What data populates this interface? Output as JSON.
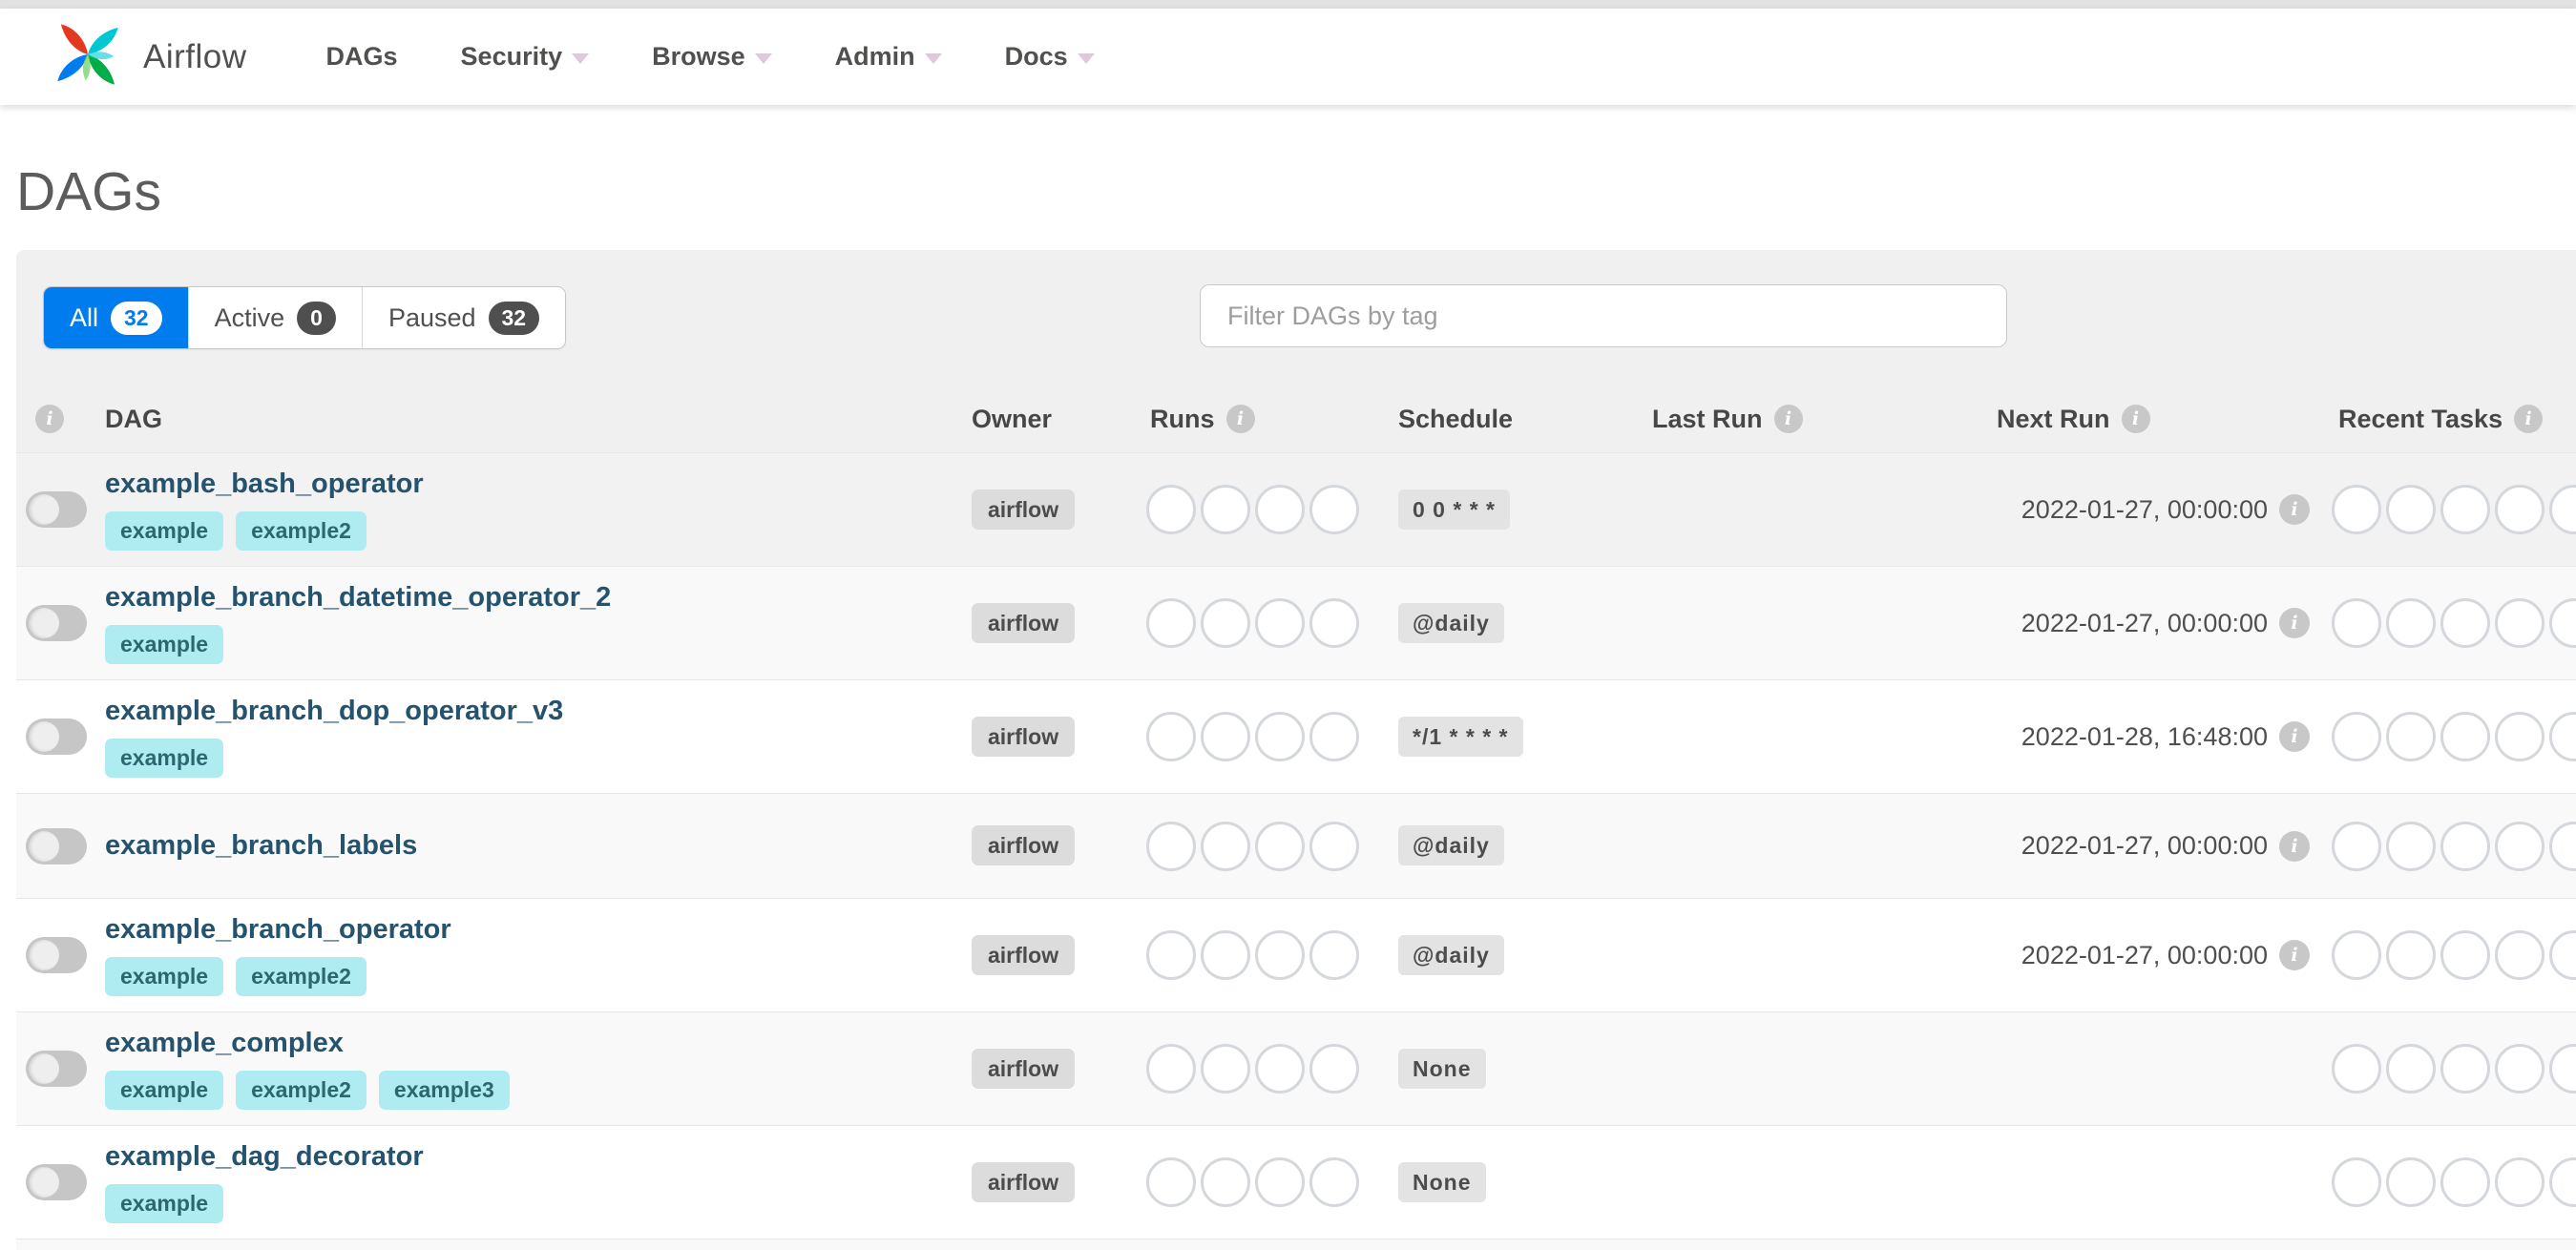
{
  "navbar": {
    "brand": "Airflow",
    "items": [
      {
        "label": "DAGs",
        "caret": false
      },
      {
        "label": "Security",
        "caret": true
      },
      {
        "label": "Browse",
        "caret": true
      },
      {
        "label": "Admin",
        "caret": true
      },
      {
        "label": "Docs",
        "caret": true
      }
    ]
  },
  "page": {
    "title": "DAGs"
  },
  "filters": {
    "tabs": [
      {
        "label": "All",
        "count": "32",
        "active": true
      },
      {
        "label": "Active",
        "count": "0",
        "active": false
      },
      {
        "label": "Paused",
        "count": "32",
        "active": false
      }
    ],
    "search_placeholder": "Filter DAGs by tag"
  },
  "table": {
    "headers": {
      "dag": "DAG",
      "owner": "Owner",
      "runs": "Runs",
      "schedule": "Schedule",
      "last_run": "Last Run",
      "next_run": "Next Run",
      "recent_tasks": "Recent Tasks"
    },
    "runs_circle_count": 4,
    "recent_circle_count": 5,
    "rows": [
      {
        "name": "example_bash_operator",
        "tags": [
          "example",
          "example2"
        ],
        "owner": "airflow",
        "schedule": "0 0 * * *",
        "last_run": "",
        "next_run": "2022-01-27, 00:00:00",
        "paused": true,
        "bg": "#f2f2f2"
      },
      {
        "name": "example_branch_datetime_operator_2",
        "tags": [
          "example"
        ],
        "owner": "airflow",
        "schedule": "@daily",
        "last_run": "",
        "next_run": "2022-01-27, 00:00:00",
        "paused": true,
        "bg": "#f9f9f9"
      },
      {
        "name": "example_branch_dop_operator_v3",
        "tags": [
          "example"
        ],
        "owner": "airflow",
        "schedule": "*/1 * * * *",
        "last_run": "",
        "next_run": "2022-01-28, 16:48:00",
        "paused": true,
        "bg": "#ffffff"
      },
      {
        "name": "example_branch_labels",
        "tags": [],
        "owner": "airflow",
        "schedule": "@daily",
        "last_run": "",
        "next_run": "2022-01-27, 00:00:00",
        "paused": true,
        "bg": "#f9f9f9"
      },
      {
        "name": "example_branch_operator",
        "tags": [
          "example",
          "example2"
        ],
        "owner": "airflow",
        "schedule": "@daily",
        "last_run": "",
        "next_run": "2022-01-27, 00:00:00",
        "paused": true,
        "bg": "#ffffff"
      },
      {
        "name": "example_complex",
        "tags": [
          "example",
          "example2",
          "example3"
        ],
        "owner": "airflow",
        "schedule": "None",
        "last_run": "",
        "next_run": "",
        "paused": true,
        "bg": "#f9f9f9"
      },
      {
        "name": "example_dag_decorator",
        "tags": [
          "example"
        ],
        "owner": "airflow",
        "schedule": "None",
        "last_run": "",
        "next_run": "",
        "paused": true,
        "bg": "#ffffff"
      }
    ]
  },
  "colors": {
    "accent_blue": "#017cee",
    "logo_red": "#e43921",
    "logo_cyan": "#00c7d4",
    "logo_green": "#00ad46",
    "logo_blue": "#017cee",
    "tag_bg": "#aeecf1",
    "tag_text": "#2d666c",
    "badge_bg": "#e3e3e3",
    "link_text": "#25536e",
    "panel_bg": "#f0f0f0"
  }
}
